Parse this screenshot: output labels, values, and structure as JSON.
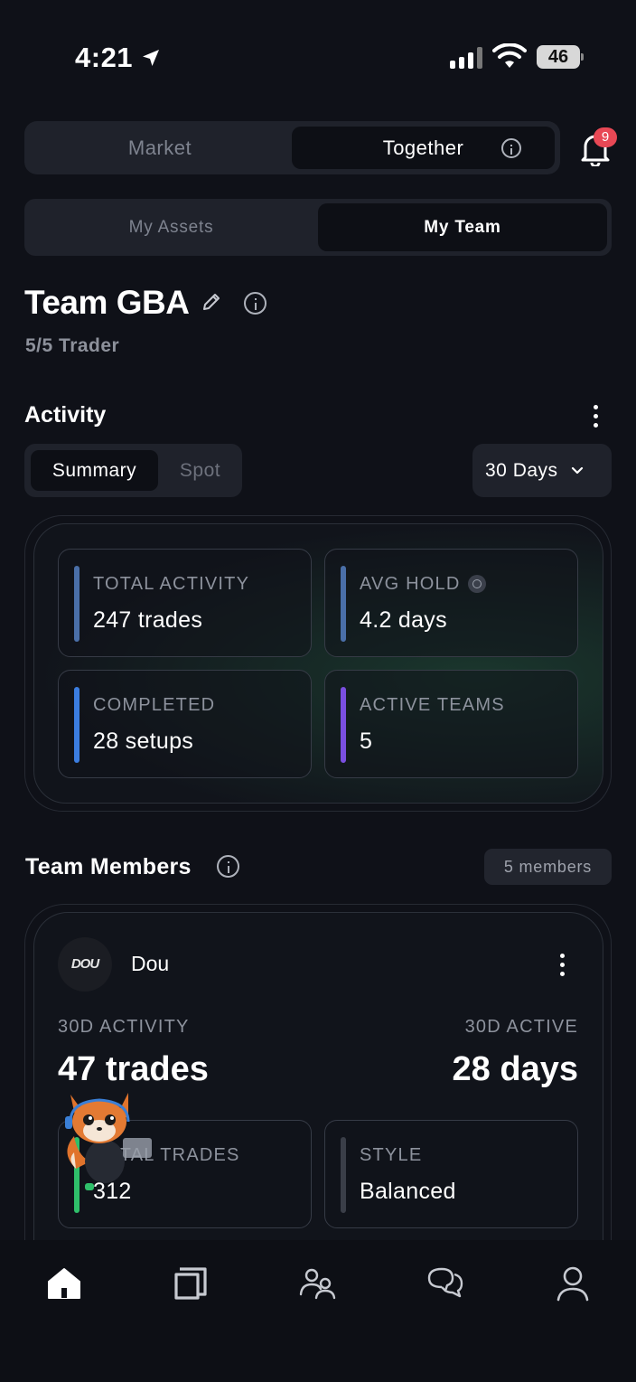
{
  "status_bar": {
    "time": "4:21",
    "battery": "46"
  },
  "top_segment": {
    "options": [
      "Market",
      "Together"
    ],
    "selected": "Together"
  },
  "notifications": {
    "count": "9"
  },
  "sub_segment": {
    "options": [
      "My Assets",
      "My Team"
    ],
    "selected": "My Team"
  },
  "team": {
    "name": "Team GBA",
    "trader_count": "5/5 Trader"
  },
  "activity": {
    "title": "Activity",
    "tabs": [
      "Summary",
      "Spot"
    ],
    "selected_tab": "Summary",
    "period": "30 Days",
    "stats": [
      {
        "label": "TOTAL ACTIVITY",
        "value": "247 trades",
        "accent": "#4a6fa8"
      },
      {
        "label": "AVG HOLD",
        "value": "4.2 days",
        "accent": "#4a6fa8"
      },
      {
        "label": "COMPLETED",
        "value": "28 setups",
        "accent": "#3b7de0"
      },
      {
        "label": "ACTIVE TEAMS",
        "value": "5",
        "accent": "#7a4fe0"
      }
    ]
  },
  "members": {
    "title": "Team Members",
    "count_badge": "5 members",
    "list": [
      {
        "avatar_text": "DOU",
        "name": "Dou",
        "left_label": "30D ACTIVITY",
        "left_value": "47 trades",
        "right_label": "30D ACTIVE",
        "right_value": "28 days",
        "cards": [
          {
            "label": "TOTAL TRADES",
            "value": "312",
            "accent": "#2fbf6a"
          },
          {
            "label": "STYLE",
            "value": "Balanced",
            "accent": "#3a3e48"
          }
        ]
      }
    ]
  },
  "tab_bar": {
    "items": [
      "home-icon",
      "ledger-icon",
      "users-icon",
      "chat-icon",
      "profile-icon"
    ]
  }
}
